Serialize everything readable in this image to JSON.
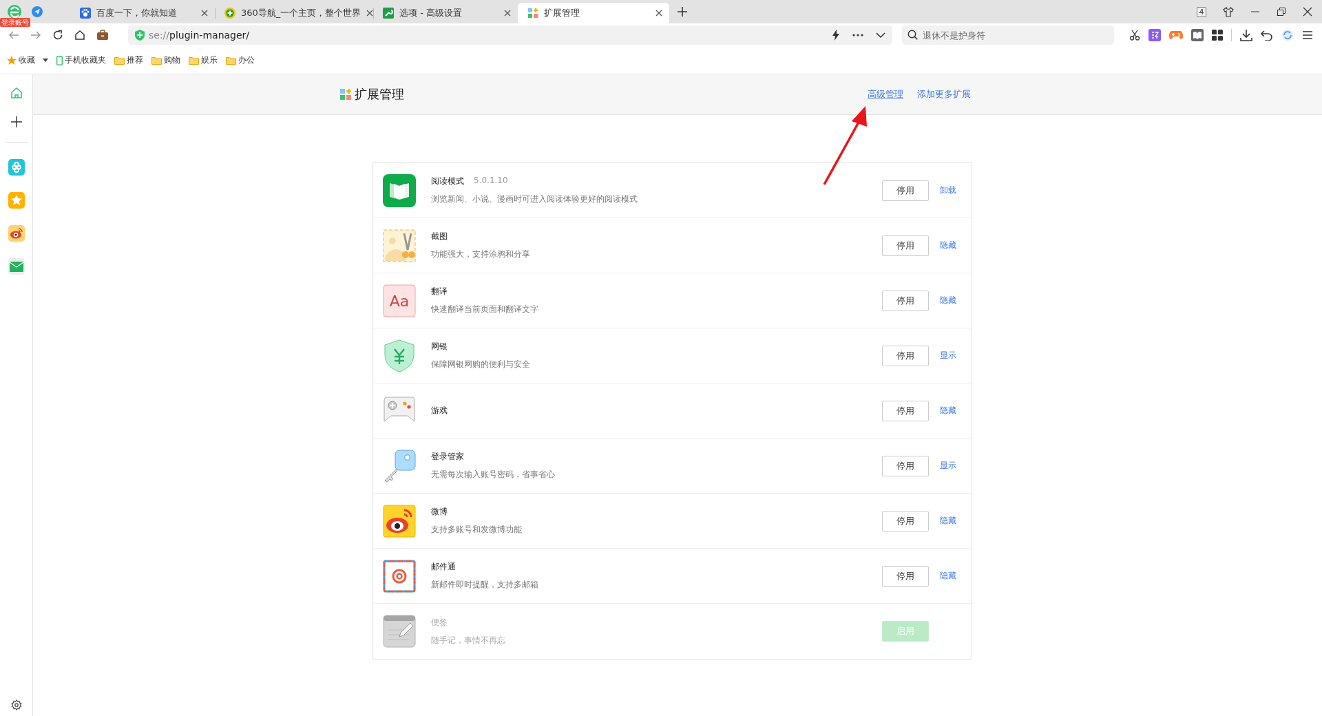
{
  "account_badge": "登录账号",
  "tabs": [
    {
      "title": "百度一下，你就知道",
      "selected": false
    },
    {
      "title": "360导航_一个主页，整个世界",
      "selected": false
    },
    {
      "title": "选项 - 高级设置",
      "selected": false
    },
    {
      "title": "扩展管理",
      "selected": true
    }
  ],
  "tab_count": "4",
  "address": {
    "scheme": "se://",
    "path": "plugin-manager/"
  },
  "search": {
    "placeholder": "退休不是护身符"
  },
  "bookmarks": [
    {
      "label": "收藏",
      "kind": "favorites"
    },
    {
      "label": "手机收藏夹",
      "kind": "phone"
    },
    {
      "label": "推荐",
      "kind": "folder"
    },
    {
      "label": "购物",
      "kind": "folder"
    },
    {
      "label": "娱乐",
      "kind": "folder"
    },
    {
      "label": "办公",
      "kind": "folder"
    }
  ],
  "page": {
    "title": "扩展管理",
    "links": [
      "高级管理",
      "添加更多扩展"
    ]
  },
  "extensions": [
    {
      "name": "阅读模式",
      "version": "5.0.1.10",
      "description": "浏览新闻、小说、漫画时可进入阅读体验更好的阅读模式",
      "enabled": true,
      "button": "停用",
      "link": "卸载"
    },
    {
      "name": "截图",
      "description": "功能强大，支持涂鸦和分享",
      "enabled": true,
      "button": "停用",
      "link": "隐藏"
    },
    {
      "name": "翻译",
      "icon_label": "Aa",
      "description": "快速翻译当前页面和翻译文字",
      "enabled": true,
      "button": "停用",
      "link": "隐藏"
    },
    {
      "name": "网银",
      "description": "保障网银网购的便利与安全",
      "enabled": true,
      "button": "停用",
      "link": "显示"
    },
    {
      "name": "游戏",
      "enabled": true,
      "button": "停用",
      "link": "隐藏"
    },
    {
      "name": "登录管家",
      "description": "无需每次输入账号密码，省事省心",
      "enabled": true,
      "button": "停用",
      "link": "显示"
    },
    {
      "name": "微博",
      "description": "支持多账号和发微博功能",
      "enabled": true,
      "button": "停用",
      "link": "隐藏"
    },
    {
      "name": "邮件通",
      "description": "新邮件即时提醒，支持多邮箱",
      "enabled": true,
      "button": "停用",
      "link": "隐藏"
    },
    {
      "name": "便签",
      "description": "随手记，事情不再忘",
      "enabled": false,
      "button": "启用"
    }
  ]
}
